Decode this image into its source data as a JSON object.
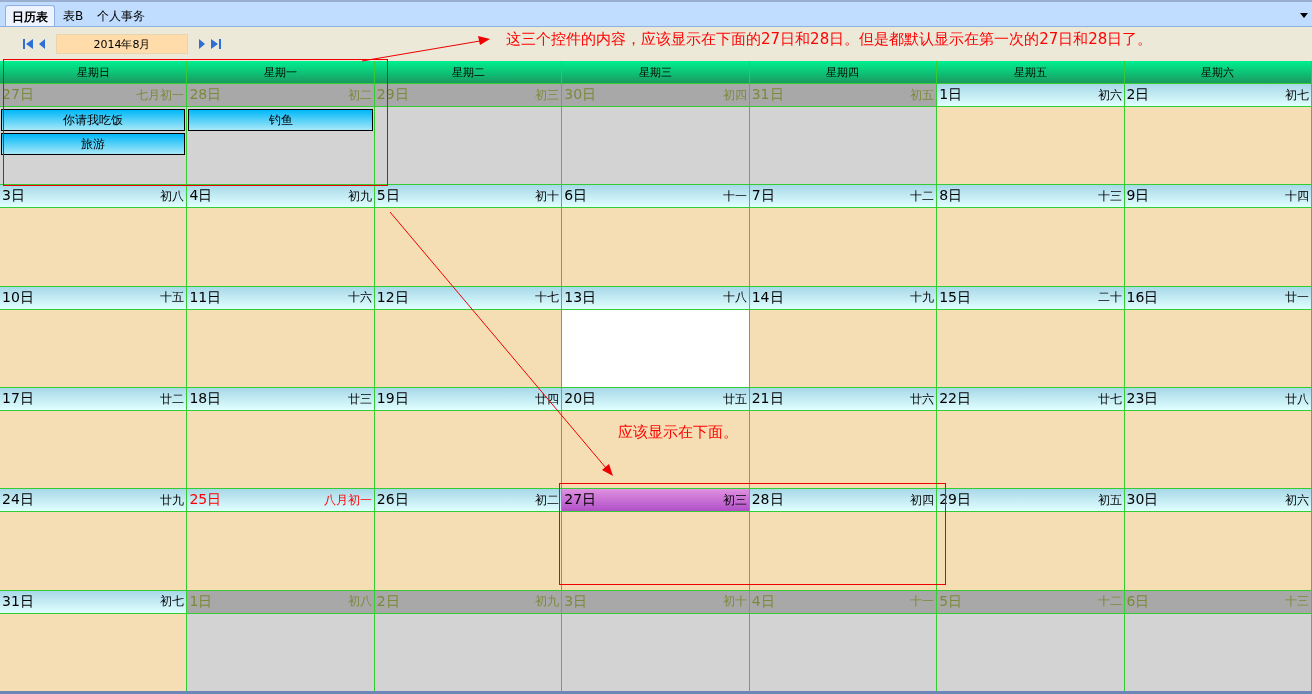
{
  "tabs": [
    {
      "label": "日历表",
      "selected": true
    },
    {
      "label": "表B",
      "selected": false
    },
    {
      "label": "个人事务",
      "selected": false
    }
  ],
  "month": "2014年8月",
  "annotations": {
    "top": "这三个控件的内容，应该显示在下面的27日和28日。但是都默认显示在第一次的27日和28日了。",
    "bottom": "应该显示在下面。"
  },
  "weekdays": [
    "星期日",
    "星期一",
    "星期二",
    "星期三",
    "星期四",
    "星期五",
    "星期六"
  ],
  "weeks": [
    [
      {
        "day": "27日",
        "lunar": "七月初一",
        "kind": "outside",
        "selected": false,
        "events": [
          "你请我吃饭",
          "旅游"
        ]
      },
      {
        "day": "28日",
        "lunar": "初二",
        "kind": "outside",
        "selected": false,
        "events": [
          "钓鱼"
        ]
      },
      {
        "day": "29日",
        "lunar": "初三",
        "kind": "outside",
        "selected": false
      },
      {
        "day": "30日",
        "lunar": "初四",
        "kind": "outside",
        "selected": false
      },
      {
        "day": "31日",
        "lunar": "初五",
        "kind": "outside",
        "selected": false
      },
      {
        "day": "1日",
        "lunar": "初六",
        "kind": "normal",
        "selected": false
      },
      {
        "day": "2日",
        "lunar": "初七",
        "kind": "normal",
        "selected": false
      }
    ],
    [
      {
        "day": "3日",
        "lunar": "初八",
        "kind": "normal",
        "selected": false
      },
      {
        "day": "4日",
        "lunar": "初九",
        "kind": "normal",
        "selected": false
      },
      {
        "day": "5日",
        "lunar": "初十",
        "kind": "normal",
        "selected": false
      },
      {
        "day": "6日",
        "lunar": "十一",
        "kind": "normal",
        "selected": false
      },
      {
        "day": "7日",
        "lunar": "十二",
        "kind": "normal",
        "selected": false
      },
      {
        "day": "8日",
        "lunar": "十三",
        "kind": "normal",
        "selected": false
      },
      {
        "day": "9日",
        "lunar": "十四",
        "kind": "normal",
        "selected": false
      }
    ],
    [
      {
        "day": "10日",
        "lunar": "十五",
        "kind": "normal",
        "selected": false
      },
      {
        "day": "11日",
        "lunar": "十六",
        "kind": "normal",
        "selected": false
      },
      {
        "day": "12日",
        "lunar": "十七",
        "kind": "normal",
        "selected": false
      },
      {
        "day": "13日",
        "lunar": "十八",
        "kind": "normal",
        "selected": true
      },
      {
        "day": "14日",
        "lunar": "十九",
        "kind": "normal",
        "selected": false
      },
      {
        "day": "15日",
        "lunar": "二十",
        "kind": "normal",
        "selected": false
      },
      {
        "day": "16日",
        "lunar": "廿一",
        "kind": "normal",
        "selected": false
      }
    ],
    [
      {
        "day": "17日",
        "lunar": "廿二",
        "kind": "normal",
        "selected": false
      },
      {
        "day": "18日",
        "lunar": "廿三",
        "kind": "normal",
        "selected": false
      },
      {
        "day": "19日",
        "lunar": "廿四",
        "kind": "normal",
        "selected": false
      },
      {
        "day": "20日",
        "lunar": "廿五",
        "kind": "normal",
        "selected": false
      },
      {
        "day": "21日",
        "lunar": "廿六",
        "kind": "normal",
        "selected": false
      },
      {
        "day": "22日",
        "lunar": "廿七",
        "kind": "normal",
        "selected": false
      },
      {
        "day": "23日",
        "lunar": "廿八",
        "kind": "normal",
        "selected": false
      }
    ],
    [
      {
        "day": "24日",
        "lunar": "廿九",
        "kind": "normal",
        "selected": false
      },
      {
        "day": "25日",
        "lunar": "八月初一",
        "kind": "festival",
        "selected": false
      },
      {
        "day": "26日",
        "lunar": "初二",
        "kind": "normal",
        "selected": false
      },
      {
        "day": "27日",
        "lunar": "初三",
        "kind": "today",
        "selected": false
      },
      {
        "day": "28日",
        "lunar": "初四",
        "kind": "normal",
        "selected": false
      },
      {
        "day": "29日",
        "lunar": "初五",
        "kind": "normal",
        "selected": false
      },
      {
        "day": "30日",
        "lunar": "初六",
        "kind": "normal",
        "selected": false
      }
    ],
    [
      {
        "day": "31日",
        "lunar": "初七",
        "kind": "normal",
        "selected": false
      },
      {
        "day": "1日",
        "lunar": "初八",
        "kind": "outside",
        "selected": false
      },
      {
        "day": "2日",
        "lunar": "初九",
        "kind": "outside",
        "selected": false
      },
      {
        "day": "3日",
        "lunar": "初十",
        "kind": "outside",
        "selected": false
      },
      {
        "day": "4日",
        "lunar": "十一",
        "kind": "outside",
        "selected": false
      },
      {
        "day": "5日",
        "lunar": "十二",
        "kind": "outside",
        "selected": false
      },
      {
        "day": "6日",
        "lunar": "十三",
        "kind": "outside",
        "selected": false
      }
    ]
  ]
}
